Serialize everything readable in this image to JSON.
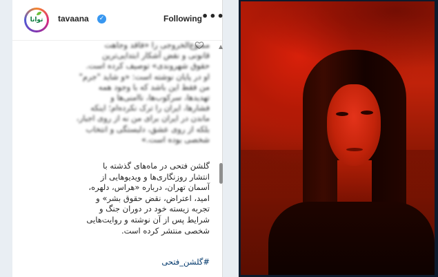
{
  "post": {
    "username": "tavaana",
    "verified_symbol": "✓",
    "avatar_logo": "توانا",
    "follow_label": "Following",
    "more_label": "•••",
    "caption_blurred_lines": [
      "ممنوع‌الخروجی را «فاقد وجاهت",
      "قانونی و نقض آشکار ابتدایی‌ترین",
      "حقوق شهروندی» توصیف کرده است.",
      "او در پایان نوشته است: «و شاید \"جرم\"",
      "من فقط این باشد که با وجود همه",
      "تهدیدها، سرکوب‌ها، ناامنی‌ها و",
      "فشارها، ایران را ترک نکرده‌ام؛ اینکه",
      "ماندن در ایران برای من نه از روی اجبار،",
      "بلکه از روی عشق، دلبستگی و انتخاب",
      "شخصی بوده است.»"
    ],
    "caption_lines": [
      "گلشن فتحی در ماه‌های گذشته با",
      "انتشار روزنگاری‌ها و ویدیوهایی از",
      "آسمان تهران، درباره «هراس، دلهره،",
      "امید، اعتراض، نقض حقوق بشر» و",
      "تجربه زیسته خود در دوران جنگ و",
      "شرایط پس از آن نوشته و روایت‌هایی",
      "شخصی منتشر کرده است."
    ],
    "hashtag": "#گلشن_فتحی"
  },
  "colors": {
    "link": "#00376b",
    "verified": "#3897f0",
    "photo_tint": "#c0220a"
  },
  "icons": {
    "heart": "heart-outline-icon",
    "collapse": "chevron-up-icon",
    "verified": "verified-badge-icon",
    "more": "more-options-icon"
  }
}
